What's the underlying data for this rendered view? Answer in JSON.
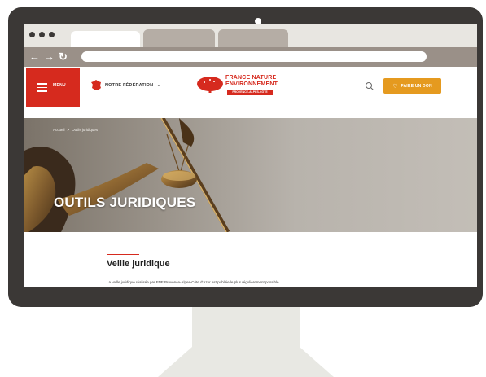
{
  "header": {
    "menu_label": "MENU",
    "federation_label": "NOTRE FÉDÉRATION",
    "logo_line1": "FRANCE NATURE",
    "logo_line2": "ENVIRONNEMENT",
    "logo_tag": "PROVENCE-ALPES-CÔTE D'AZUR",
    "donate_label": "FAIRE UN DON"
  },
  "hero": {
    "breadcrumb_home": "Accueil",
    "breadcrumb_sep": ">",
    "breadcrumb_current": "Outils juridiques",
    "title": "OUTILS JURIDIQUES"
  },
  "content": {
    "section_title": "Veille juridique",
    "intro": "La veille juridique réalisée par FNE Provence-Alpes-Côte d'Azur est publiée le plus régulièrement possible."
  },
  "colors": {
    "brand_red": "#d62a1e",
    "donate_orange": "#e59a1f",
    "monitor_frame": "#3b3836"
  }
}
